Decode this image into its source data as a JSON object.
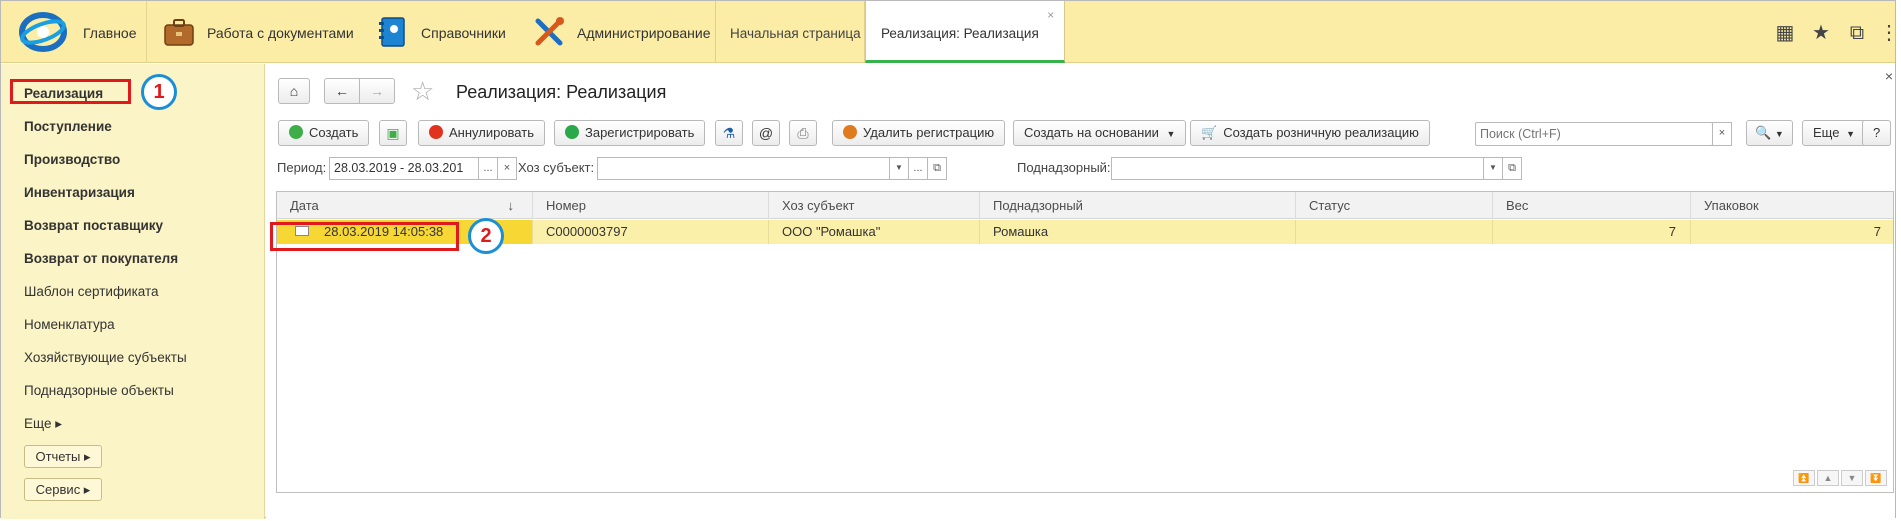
{
  "topbar": {
    "home_label": "Главное",
    "sections": [
      {
        "label": "Работа с документами",
        "icon": "briefcase-icon"
      },
      {
        "label": "Справочники",
        "icon": "book-icon"
      },
      {
        "label": "Администрирование",
        "icon": "tools-icon"
      }
    ],
    "tabs": [
      {
        "label": "Начальная страница"
      },
      {
        "label": "Реализация: Реализация",
        "close": "×"
      }
    ],
    "tools": {
      "apps": "▦",
      "favorites": "★",
      "history": "⧉",
      "more": "⋮"
    }
  },
  "sidebar": {
    "items": [
      {
        "label": "Реализация"
      },
      {
        "label": "Поступление"
      },
      {
        "label": "Производство"
      },
      {
        "label": "Инвентаризация"
      },
      {
        "label": "Возврат поставщику"
      },
      {
        "label": "Возврат от покупателя"
      },
      {
        "label": "Шаблон сертификата"
      },
      {
        "label": "Номенклатура"
      },
      {
        "label": "Хозяйствующие субъекты"
      },
      {
        "label": "Поднадзорные объекты"
      },
      {
        "label": "Еще ▸"
      }
    ],
    "buttons": [
      {
        "label": "Отчеты ▸"
      },
      {
        "label": "Сервис ▸"
      }
    ]
  },
  "markers": {
    "m1": "1",
    "m2": "2"
  },
  "main": {
    "title": "Реализация: Реализация",
    "close": "×",
    "toolbar": {
      "create": "Создать",
      "annul": "Аннулировать",
      "register": "Зарегистрировать",
      "at": "@",
      "delete_reg": "Удалить регистрацию",
      "create_based": "Создать на основании",
      "create_retail": "Создать розничную реализацию",
      "search_placeholder": "Поиск (Ctrl+F)",
      "search_clear": "×",
      "more": "Еще",
      "help": "?"
    },
    "filters": {
      "period_label": "Период:",
      "period_value": "28.03.2019 - 28.03.201",
      "subject_label": "Хоз субъект:",
      "subject_value": "",
      "supervised_label": "Поднадзорный:",
      "supervised_value": ""
    },
    "table": {
      "columns": [
        "Дата",
        "Номер",
        "Хоз субъект",
        "Поднадзорный",
        "Статус",
        "Вес",
        "Упаковок"
      ],
      "sort_indicator": "↓",
      "rows": [
        {
          "date": "28.03.2019 14:05:38",
          "number": "C0000003797",
          "subject": "ООО \"Ромашка\"",
          "supervised": "Ромашка",
          "status": "",
          "weight": "7",
          "packages": "7"
        }
      ]
    }
  }
}
